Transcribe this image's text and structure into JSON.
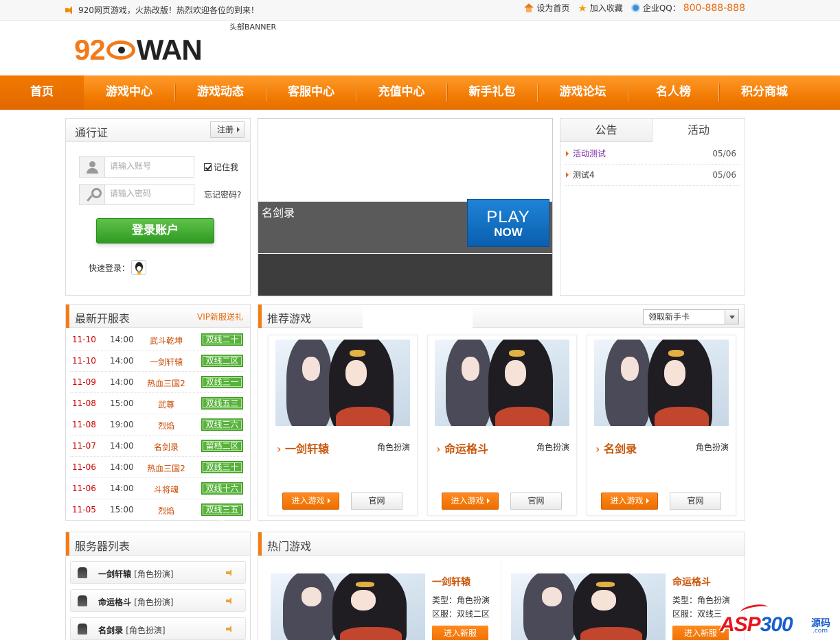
{
  "topbar": {
    "notice": "920网页游戏，火热改版！热烈欢迎各位的到来！",
    "set_home": "设为首页",
    "add_favorite": "加入收藏",
    "qq_label": "企业QQ：",
    "qq_number": "800-888-888"
  },
  "header": {
    "logo_num": "920",
    "logo_text": "WAN",
    "banner_label": "头部BANNER"
  },
  "nav": [
    "首页",
    "游戏中心",
    "游戏动态",
    "客服中心",
    "充值中心",
    "新手礼包",
    "游戏论坛",
    "名人榜",
    "积分商城"
  ],
  "login": {
    "title": "通行证",
    "register": "注册",
    "username_placeholder": "请输入账号",
    "password_placeholder": "请输入密码",
    "remember": "记住我",
    "forgot": "忘记密码?",
    "submit": "登录账户",
    "quick_login": "快速登录："
  },
  "banner": {
    "game_name": "名剑录",
    "play": "PLAY",
    "now": "NOW"
  },
  "notices": {
    "tab_notice": "公告",
    "tab_activity": "活动",
    "items": [
      {
        "title": "活动测试",
        "date": "05/06"
      },
      {
        "title": "测试4",
        "date": "05/06"
      }
    ]
  },
  "new_servers": {
    "title": "最新开服表",
    "vip": "VIP新服送礼",
    "rows": [
      {
        "date": "11-10",
        "time": "14:00",
        "game": "武斗乾坤",
        "server": "双线二十区"
      },
      {
        "date": "11-10",
        "time": "14:00",
        "game": "一剑轩辕",
        "server": "双线二区"
      },
      {
        "date": "11-09",
        "time": "14:00",
        "game": "热血三国2",
        "server": "双线三一区"
      },
      {
        "date": "11-08",
        "time": "15:00",
        "game": "武尊",
        "server": "双线五三区"
      },
      {
        "date": "11-08",
        "time": "19:00",
        "game": "烈焰",
        "server": "双线三六区"
      },
      {
        "date": "11-07",
        "time": "14:00",
        "game": "名剑录",
        "server": "留档二区"
      },
      {
        "date": "11-06",
        "time": "14:00",
        "game": "热血三国2",
        "server": "双线三十区"
      },
      {
        "date": "11-06",
        "time": "14:00",
        "game": "斗将魂",
        "server": "双线十六区"
      },
      {
        "date": "11-05",
        "time": "15:00",
        "game": "烈焰",
        "server": "双线三五区"
      }
    ]
  },
  "recommend": {
    "title": "推荐游戏",
    "select": "领取新手卡",
    "enter": "进入游戏",
    "official": "官网",
    "games": [
      {
        "name": "一剑轩辕",
        "genre": "角色扮演"
      },
      {
        "name": "命运格斗",
        "genre": "角色扮演"
      },
      {
        "name": "名剑录",
        "genre": "角色扮演"
      }
    ]
  },
  "server_list": {
    "title": "服务器列表",
    "items": [
      {
        "name": "一剑轩辕",
        "genre": "[角色扮演]"
      },
      {
        "name": "命运格斗",
        "genre": "[角色扮演]"
      },
      {
        "name": "名剑录",
        "genre": "[角色扮演]"
      }
    ]
  },
  "hot_games": {
    "title": "热门游戏",
    "items": [
      {
        "name": "一剑轩辕",
        "type": "类型：角色扮演",
        "zone": "区服：双线二区",
        "button": "进入新服"
      },
      {
        "name": "命运格斗",
        "type": "类型：角色扮演",
        "zone": "区服：双线三",
        "button": "进入新服"
      }
    ]
  },
  "watermark": {
    "text_a": "ASP",
    "text_b": "300",
    "cn": "源码",
    "com": ".com"
  },
  "colors": {
    "accent": "#f07800",
    "link_orange": "#e96b10",
    "green": "#3e9a23"
  }
}
